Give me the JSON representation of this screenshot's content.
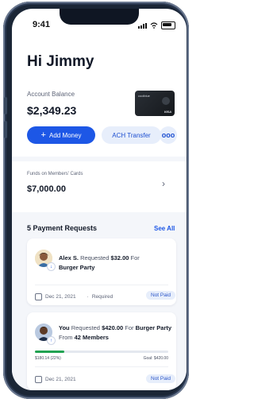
{
  "status_bar": {
    "time": "9:41"
  },
  "greeting": "Hi Jimmy",
  "account": {
    "label": "Account Balance",
    "balance": "$2,349.23",
    "card_brand": "coolblue",
    "card_network": "VISA"
  },
  "actions": {
    "add_money": "Add Money",
    "ach_transfer": "ACH Transfer",
    "more": "ooo"
  },
  "funds": {
    "label": "Funds on Members' Cards",
    "value": "$7,000.00"
  },
  "requests": {
    "title": "5 Payment Requests",
    "see_all": "See All",
    "items": [
      {
        "name": "Alex S.",
        "verb": " Requested ",
        "amount": "$32.00",
        "for_word": " For",
        "purpose": "Burger Party",
        "date": "Dec 21, 2021",
        "type": "Required",
        "status": "Not Paid"
      },
      {
        "name": "You",
        "verb": " Requested ",
        "amount": "$420.00",
        "for_word": " For ",
        "purpose": "Burger Party",
        "from_word": " From ",
        "members": "42 Members",
        "collected": "$180.14 (22%)",
        "goal": "Goal: $420.00",
        "progress": 0.22,
        "date": "Dec 21, 2021",
        "status": "Not Paid"
      }
    ]
  },
  "colors": {
    "accent": "#1d57e6",
    "progress": "#22a352",
    "pill_bg": "#e7eefb"
  }
}
